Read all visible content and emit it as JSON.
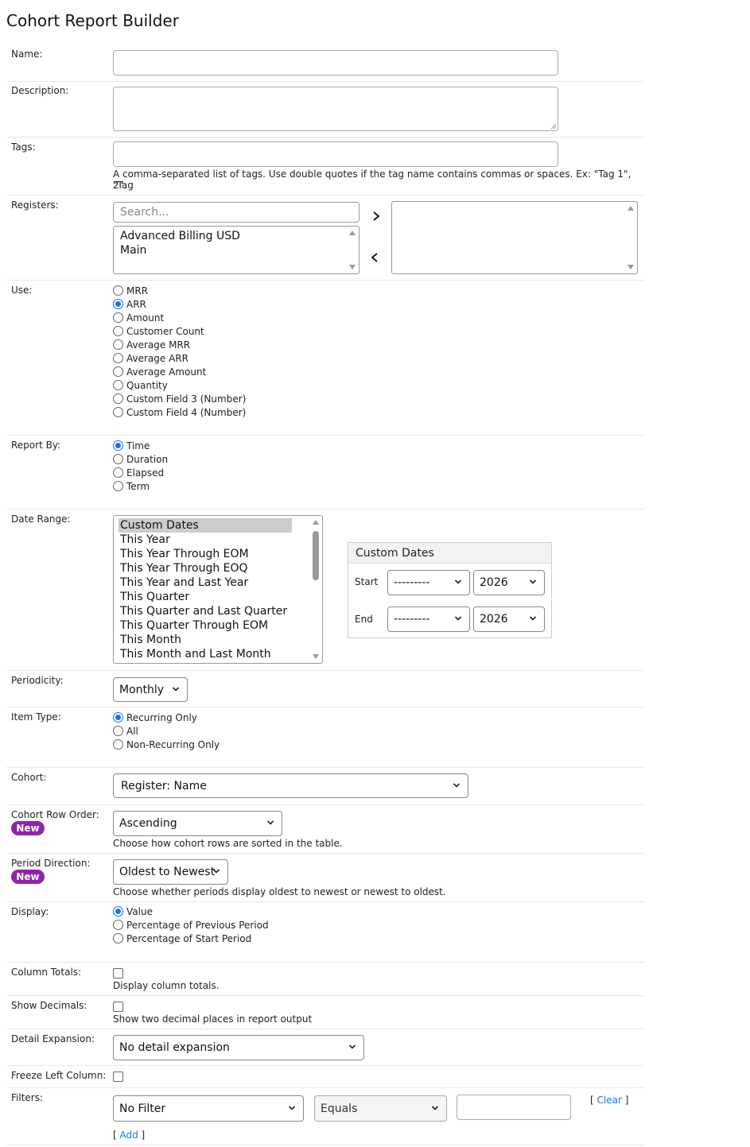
{
  "page": {
    "title": "Cohort Report Builder"
  },
  "fields": {
    "name": {
      "label": "Name:",
      "value": ""
    },
    "description": {
      "label": "Description:",
      "value": ""
    },
    "tags": {
      "label": "Tags:",
      "value": "",
      "help": "A comma-separated list of tags. Use double quotes if the tag name contains commas or spaces. Ex: \"Tag 1\", \"Tag",
      "help2": "2\"."
    },
    "registers": {
      "label": "Registers:",
      "search_placeholder": "Search...",
      "available": [
        "Advanced Billing USD",
        "Main"
      ],
      "selected": [],
      "add_icon": "chevron-right-icon",
      "remove_icon": "chevron-left-icon"
    },
    "use": {
      "label": "Use:",
      "options": [
        "MRR",
        "ARR",
        "Amount",
        "Customer Count",
        "Average MRR",
        "Average ARR",
        "Average Amount",
        "Quantity",
        "Custom Field 3 (Number)",
        "Custom Field 4 (Number)"
      ],
      "selected": "ARR"
    },
    "report_by": {
      "label": "Report By:",
      "options": [
        "Time",
        "Duration",
        "Elapsed",
        "Term"
      ],
      "selected": "Time"
    },
    "date_range": {
      "label": "Date Range:",
      "options": [
        "Custom Dates",
        "This Year",
        "This Year Through EOM",
        "This Year Through EOQ",
        "This Year and Last Year",
        "This Quarter",
        "This Quarter and Last Quarter",
        "This Quarter Through EOM",
        "This Month",
        "This Month and Last Month"
      ],
      "selected": "Custom Dates",
      "custom": {
        "header": "Custom Dates",
        "start_label": "Start",
        "end_label": "End",
        "start_month": "---------",
        "start_year": "2026",
        "end_month": "---------",
        "end_year": "2026"
      }
    },
    "periodicity": {
      "label": "Periodicity:",
      "value": "Monthly"
    },
    "item_type": {
      "label": "Item Type:",
      "options": [
        "Recurring Only",
        "All",
        "Non-Recurring Only"
      ],
      "selected": "Recurring Only"
    },
    "cohort": {
      "label": "Cohort:",
      "value": "Register: Name"
    },
    "cohort_row_order": {
      "label": "Cohort Row Order:",
      "badge": "New",
      "value": "Ascending",
      "help": "Choose how cohort rows are sorted in the table."
    },
    "period_direction": {
      "label": "Period Direction:",
      "badge": "New",
      "value": "Oldest to Newest",
      "help": "Choose whether periods display oldest to newest or newest to oldest."
    },
    "display": {
      "label": "Display:",
      "options": [
        "Value",
        "Percentage of Previous Period",
        "Percentage of Start Period"
      ],
      "selected": "Value"
    },
    "column_totals": {
      "label": "Column Totals:",
      "help": "Display column totals.",
      "checked": false
    },
    "show_decimals": {
      "label": "Show Decimals:",
      "help": "Show two decimal places in report output",
      "checked": false
    },
    "detail_expansion": {
      "label": "Detail Expansion:",
      "value": "No detail expansion"
    },
    "freeze_left_column": {
      "label": "Freeze Left Column:",
      "checked": false
    },
    "filters": {
      "label": "Filters:",
      "field": "No Filter",
      "operator": "Equals",
      "value": "",
      "clear_label": "Clear",
      "add_label": "Add"
    }
  },
  "colors": {
    "accent": "#1a73e8",
    "badge": "#8e24aa",
    "selected_option_bg": "#cccccc",
    "divider": "#e8e8e8"
  }
}
